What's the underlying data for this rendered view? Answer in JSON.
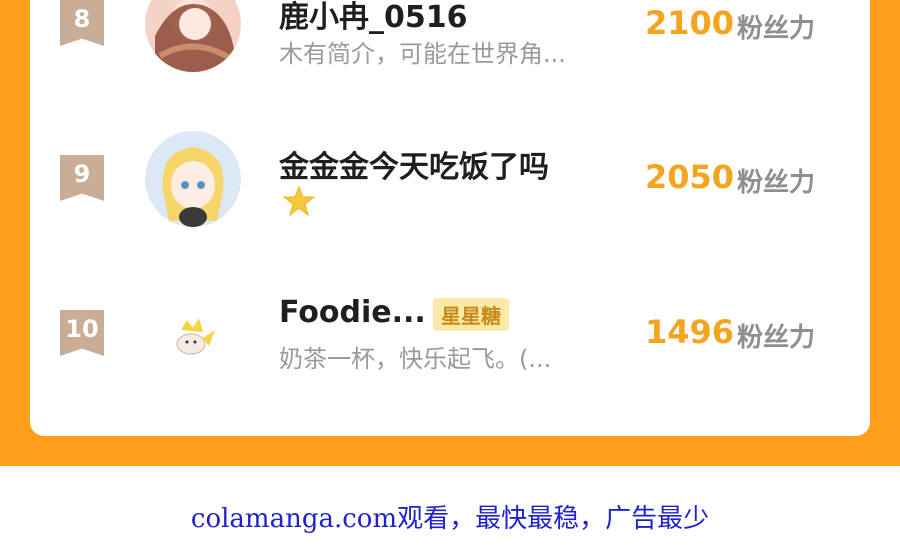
{
  "colors": {
    "frame": "#ff9f1c",
    "score": "#f3a520",
    "rank_ribbon": "#c9ad96",
    "footer_link": "#2222cc"
  },
  "ranking": {
    "rows": [
      {
        "rank": "8",
        "name": "鹿小冉_0516",
        "bio": "木有简介，可能在世界角...",
        "score": "2100",
        "unit": "粉丝力",
        "avatar": "girl-portrait-avatar"
      },
      {
        "rank": "9",
        "name": "金金金今天吃饭了吗",
        "icon": "star-icon",
        "score": "2050",
        "unit": "粉丝力",
        "avatar": "blonde-anime-girl-avatar"
      },
      {
        "rank": "10",
        "name": "Foodie...",
        "badge": "星星糖",
        "bio": "奶茶一杯，快乐起飞。(...",
        "score": "1496",
        "unit": "粉丝力",
        "avatar": "pikachu-bun-avatar"
      }
    ]
  },
  "footer": {
    "text": "colamanga.com观看，最快最稳，广告最少"
  }
}
